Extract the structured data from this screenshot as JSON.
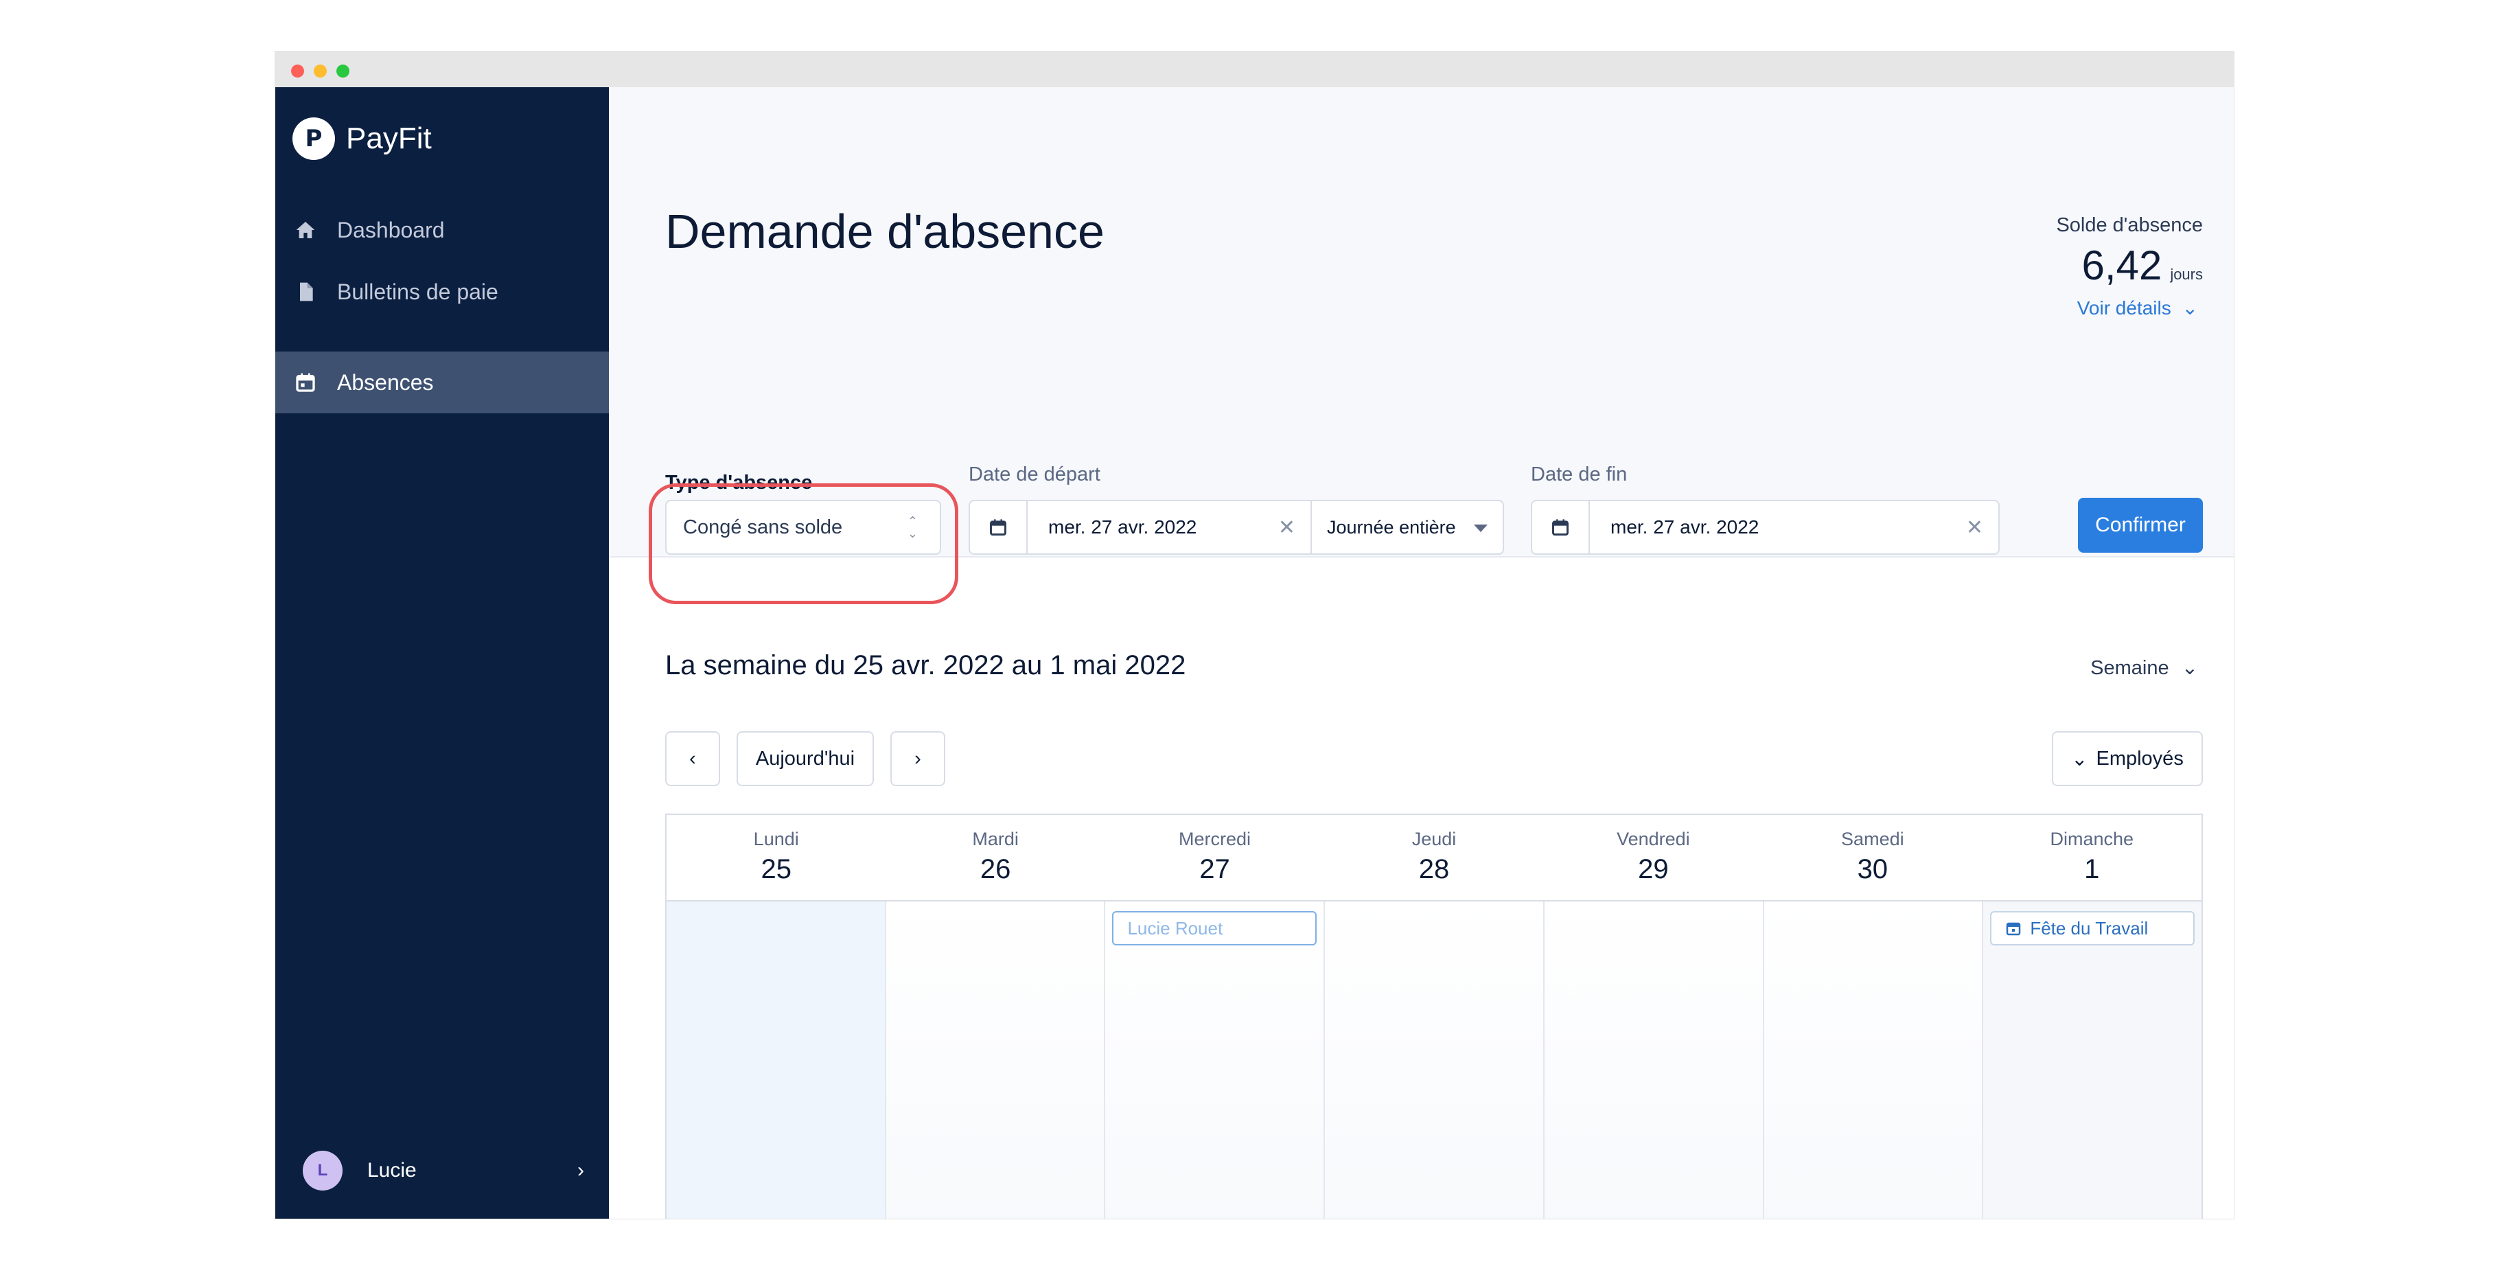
{
  "app": {
    "name": "PayFit",
    "logo_letter": "P"
  },
  "sidebar": {
    "items": [
      {
        "label": "Dashboard",
        "icon": "home-icon"
      },
      {
        "label": "Bulletins de paie",
        "icon": "document-icon"
      },
      {
        "label": "Absences",
        "icon": "calendar-icon",
        "active": true
      }
    ],
    "user": {
      "initial": "L",
      "name": "Lucie"
    }
  },
  "header": {
    "title": "Demande d'absence",
    "balance_label": "Solde d'absence",
    "balance_value": "6,42",
    "balance_unit": "jours",
    "details_link": "Voir détails"
  },
  "form": {
    "type_label": "Type d'absence",
    "type_value": "Congé sans solde",
    "start_label": "Date de départ",
    "start_value": "mer. 27 avr. 2022",
    "duration_value": "Journée entière",
    "end_label": "Date de fin",
    "end_value": "mer. 27 avr. 2022",
    "confirm_label": "Confirmer"
  },
  "calendar": {
    "week_title": "La semaine du 25 avr. 2022 au 1 mai 2022",
    "view_label": "Semaine",
    "today_label": "Aujourd'hui",
    "employees_label": "Employés",
    "days": [
      {
        "name": "Lundi",
        "num": "25"
      },
      {
        "name": "Mardi",
        "num": "26"
      },
      {
        "name": "Mercredi",
        "num": "27"
      },
      {
        "name": "Jeudi",
        "num": "28"
      },
      {
        "name": "Vendredi",
        "num": "29"
      },
      {
        "name": "Samedi",
        "num": "30"
      },
      {
        "name": "Dimanche",
        "num": "1"
      }
    ],
    "events": {
      "wednesday": "Lucie Rouet",
      "sunday": "Fête du Travail"
    }
  },
  "colors": {
    "sidebar": "#0b1f40",
    "accent": "#2a7ee0",
    "highlight": "#e8555a"
  }
}
